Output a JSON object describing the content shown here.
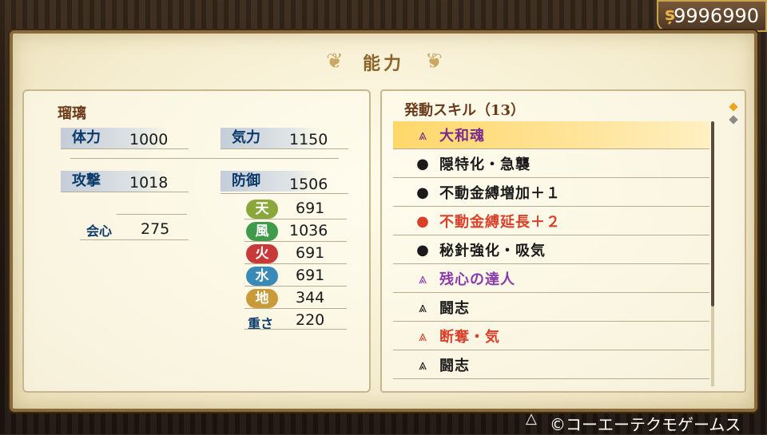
{
  "currency": {
    "amount": "9996990",
    "icon": "coin-icon"
  },
  "header": {
    "title": "能力"
  },
  "character": {
    "name": "瑠璃"
  },
  "stats": {
    "hp_label": "体力",
    "hp_value": "1000",
    "ki_label": "気力",
    "ki_value": "1150",
    "atk_label": "攻撃",
    "atk_value": "1018",
    "def_label": "防御",
    "def_value": "1506",
    "crit_label": "会心",
    "crit_value": "275"
  },
  "elements": [
    {
      "label": "天",
      "value": "691",
      "color": "#8aa83a"
    },
    {
      "label": "風",
      "value": "1036",
      "color": "#3f9a4a"
    },
    {
      "label": "火",
      "value": "691",
      "color": "#c83a3a"
    },
    {
      "label": "水",
      "value": "691",
      "color": "#3a8ab8"
    },
    {
      "label": "地",
      "value": "344",
      "color": "#c89a3a"
    }
  ],
  "weight": {
    "label": "重さ",
    "value": "220"
  },
  "skills": {
    "header": "発動スキル（13）",
    "items": [
      {
        "name": "大和魂",
        "icon": "triple-chevron-icon",
        "color": "#7a2a8a",
        "selected": true
      },
      {
        "name": "隠特化・急襲",
        "icon": "magatama-icon",
        "color": "#1a1a1a"
      },
      {
        "name": "不動金縛増加＋１",
        "icon": "magatama-icon",
        "color": "#1a1a1a"
      },
      {
        "name": "不動金縛延長＋２",
        "icon": "magatama-icon",
        "color": "#d8402a"
      },
      {
        "name": "秘針強化・吸気",
        "icon": "magatama-icon",
        "color": "#1a1a1a"
      },
      {
        "name": "残心の達人",
        "icon": "triple-chevron-icon",
        "color": "#8a3aaa"
      },
      {
        "name": "闘志",
        "icon": "triple-chevron-icon",
        "color": "#1a1a1a"
      },
      {
        "name": "断奪・気",
        "icon": "triple-chevron-icon",
        "color": "#d8402a"
      },
      {
        "name": "闘志",
        "icon": "triple-chevron-icon",
        "color": "#1a1a1a"
      }
    ]
  },
  "footer": {
    "triangle": "△",
    "copyright": "©コーエーテクモゲームス"
  }
}
